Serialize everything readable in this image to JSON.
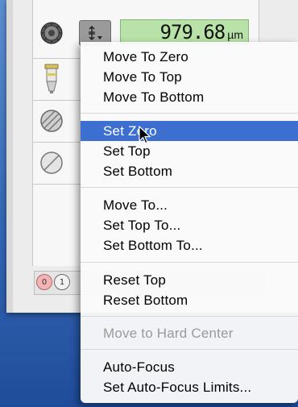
{
  "readout": {
    "value": "979.68",
    "unit": "µm"
  },
  "stepper": {
    "icon": "stepper-arrows-icon"
  },
  "side_icons": [
    "focus-knob-icon",
    "objective-lens-icon",
    "filter-disc-icon",
    "filter-disc-icon"
  ],
  "bottom_buttons": [
    "0",
    "1"
  ],
  "menu": {
    "items": [
      {
        "label": "Move To Zero"
      },
      {
        "label": "Move To Top"
      },
      {
        "label": "Move To Bottom"
      },
      {
        "label": "Set Zero"
      },
      {
        "label": "Set Top"
      },
      {
        "label": "Set Bottom"
      },
      {
        "label": "Move To..."
      },
      {
        "label": "Set Top To..."
      },
      {
        "label": "Set Bottom To..."
      },
      {
        "label": "Reset Top"
      },
      {
        "label": "Reset Bottom"
      },
      {
        "label": "Move to Hard Center"
      },
      {
        "label": "Auto-Focus"
      },
      {
        "label": "Set Auto-Focus Limits..."
      }
    ],
    "highlighted": "Set Zero",
    "disabled": "Move to Hard Center"
  }
}
